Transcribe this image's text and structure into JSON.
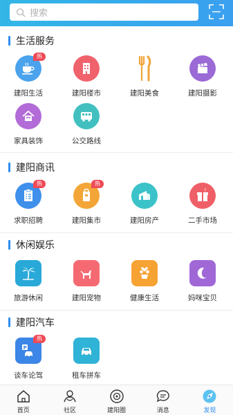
{
  "search": {
    "placeholder": "搜索"
  },
  "sections": [
    {
      "title": "生活服务",
      "items": [
        {
          "label": "建阳生活",
          "icon": "teacup-icon",
          "color": "#4aa3ec",
          "badge": "热"
        },
        {
          "label": "建阳楼市",
          "icon": "building-icon",
          "color": "#f0626c"
        },
        {
          "label": "建阳美食",
          "icon": "fork-knife-icon",
          "color": "#f0a43a"
        },
        {
          "label": "建阳摄影",
          "icon": "clapperboard-icon",
          "color": "#9b6ad6"
        },
        {
          "label": "家具装饰",
          "icon": "house-icon",
          "color": "#b36bd8"
        },
        {
          "label": "公交路线",
          "icon": "bus-icon",
          "color": "#42c0c0"
        }
      ]
    },
    {
      "title": "建阳商讯",
      "items": [
        {
          "label": "求职招聘",
          "icon": "clipboard-icon",
          "color": "#3e90ea",
          "badge": "热"
        },
        {
          "label": "建阳集市",
          "icon": "shopping-bag-icon",
          "color": "#f3a637",
          "badge": "热"
        },
        {
          "label": "建阳房产",
          "icon": "house-sale-icon",
          "color": "#3cc3c9"
        },
        {
          "label": "二手市场",
          "icon": "gift-box-icon",
          "color": "#ef5f68"
        }
      ]
    },
    {
      "title": "休闲娱乐",
      "items": [
        {
          "label": "旅游休闲",
          "icon": "palm-tree-icon",
          "color": "#28a9d8"
        },
        {
          "label": "建阳宠物",
          "icon": "dog-icon",
          "color": "#f56a72"
        },
        {
          "label": "健康生活",
          "icon": "flower-pot-icon",
          "color": "#f6a334"
        },
        {
          "label": "妈咪宝贝",
          "icon": "baby-icon",
          "color": "#a068d6"
        }
      ]
    },
    {
      "title": "建阳汽车",
      "items": [
        {
          "label": "谈车论驾",
          "icon": "parking-car-icon",
          "color": "#3b86e6",
          "badge": "热"
        },
        {
          "label": "租车拼车",
          "icon": "car-icon",
          "color": "#2fb3d6"
        }
      ]
    }
  ],
  "tabbar": [
    {
      "label": "首页",
      "icon": "home-icon"
    },
    {
      "label": "社区",
      "icon": "community-icon"
    },
    {
      "label": "建阳圈",
      "icon": "circle-icon"
    },
    {
      "label": "消息",
      "icon": "message-icon"
    },
    {
      "label": "发现",
      "icon": "discover-icon",
      "active": true
    }
  ],
  "colors": {
    "accent": "#2f8ef0",
    "header_start": "#33b7e6",
    "header_end": "#3a9ff0",
    "badge": "#ef4a56"
  }
}
